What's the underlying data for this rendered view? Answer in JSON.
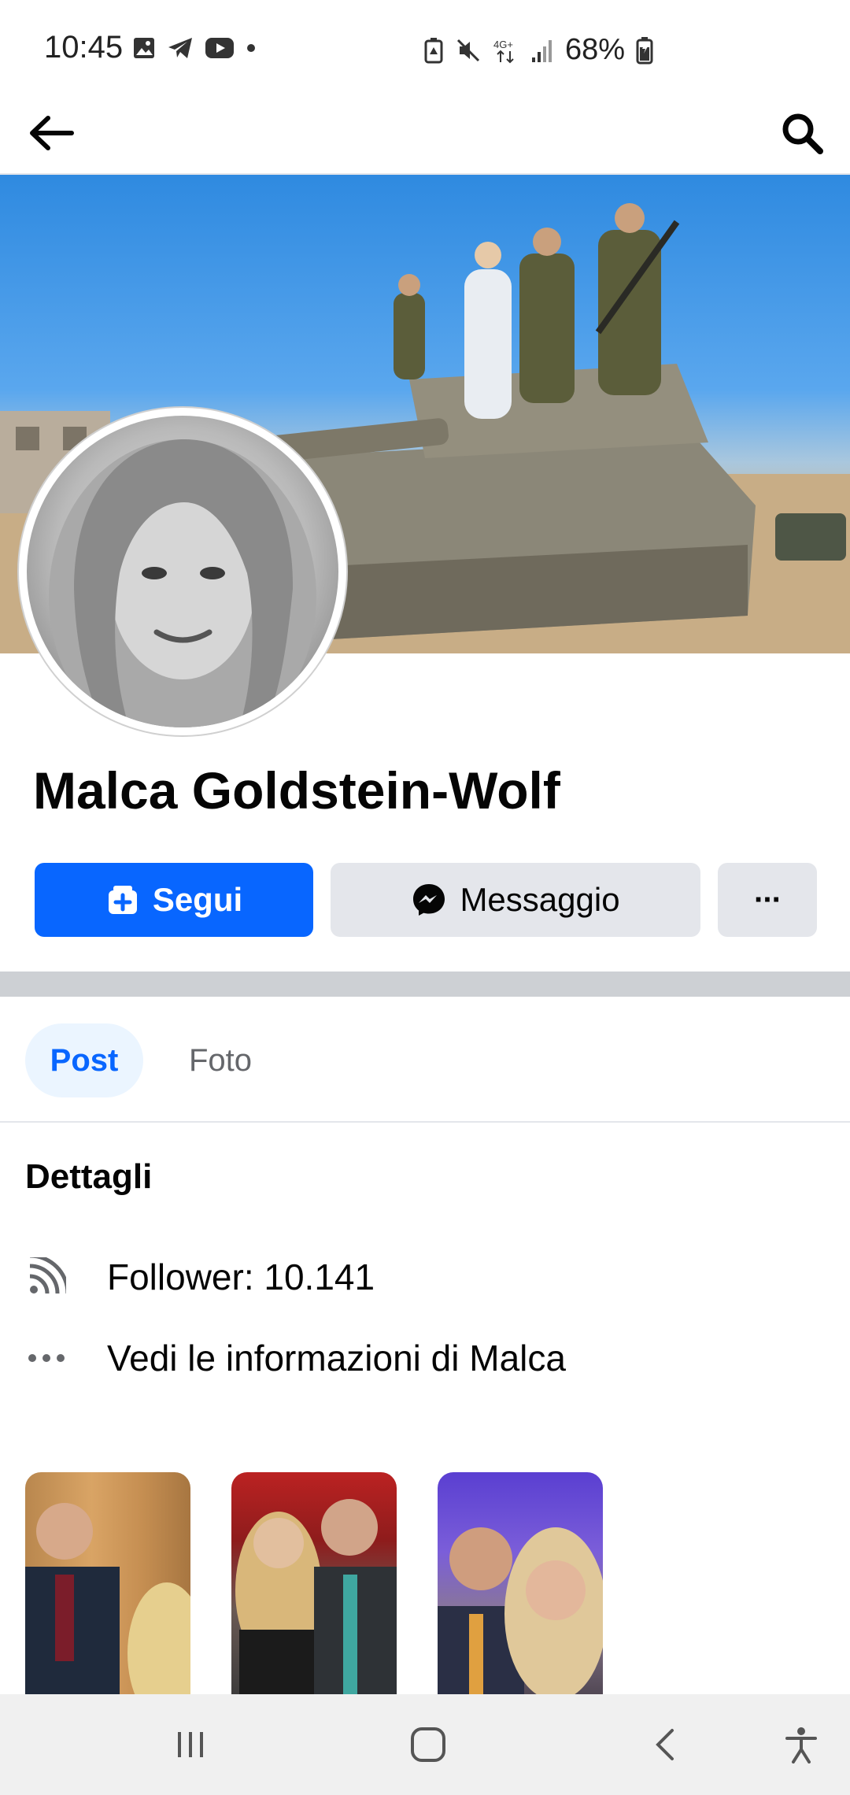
{
  "status_bar": {
    "time": "10:45",
    "battery": "68%",
    "left_icons": [
      "gallery-icon",
      "telegram-icon",
      "youtube-icon",
      "dot-icon"
    ],
    "right_icons": [
      "battery-saver-icon",
      "mute-icon",
      "4g-icon",
      "signal-icon",
      "battery-icon"
    ]
  },
  "app_bar": {
    "back_icon": "arrow-left-icon",
    "search_icon": "search-icon"
  },
  "profile": {
    "name": "Malca Goldstein-Wolf"
  },
  "actions": {
    "follow_label": "Segui",
    "message_label": "Messaggio",
    "more_label": "···"
  },
  "tabs": [
    {
      "label": "Post",
      "active": true
    },
    {
      "label": "Foto",
      "active": false
    }
  ],
  "details": {
    "title": "Dettagli",
    "followers": "Follower: 10.141",
    "info": "Vedi le informazioni di Malca"
  },
  "colors": {
    "accent": "#0866ff",
    "button_gray": "#e4e6eb",
    "tab_active_bg": "#ebf5ff"
  }
}
